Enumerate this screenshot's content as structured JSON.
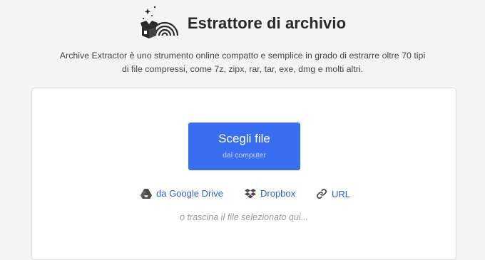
{
  "header": {
    "title": "Estrattore di archivio",
    "description_line1": "Archive Extractor è uno strumento online compatto e semplice in grado di estrarre oltre 70 tipi",
    "description_line2": "di file compressi, come 7z, zipx, rar, tar, exe, dmg e molti altri.",
    "logo_icon": "archive-rainbow-box-icon"
  },
  "upload": {
    "choose_label": "Scegli file",
    "choose_sublabel": "dal computer",
    "accent_color": "#3a6ef2"
  },
  "sources": [
    {
      "label": "da Google Drive",
      "icon": "google-drive-icon"
    },
    {
      "label": "Dropbox",
      "icon": "dropbox-icon"
    },
    {
      "label": "URL",
      "icon": "link-icon"
    }
  ],
  "drop_hint": "o trascina il file selezionato qui..."
}
